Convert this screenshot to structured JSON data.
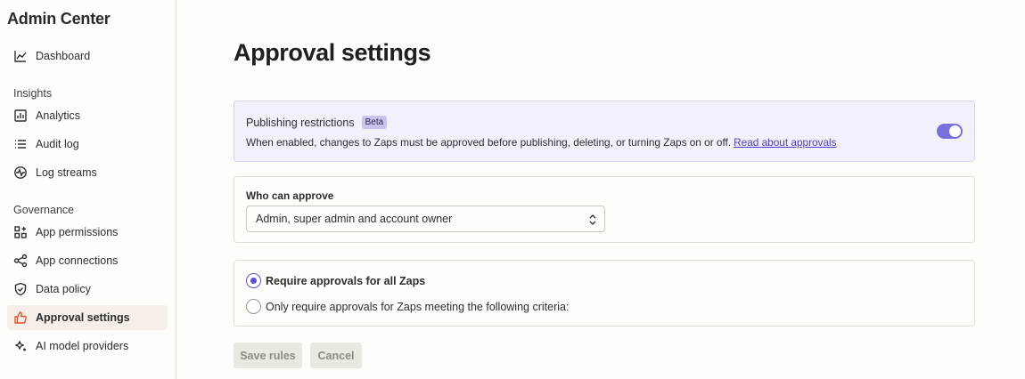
{
  "sidebar": {
    "title": "Admin Center",
    "items_top": [
      {
        "label": "Dashboard",
        "icon": "chart-line-icon"
      }
    ],
    "insights": {
      "title": "Insights",
      "items": [
        {
          "label": "Analytics",
          "icon": "bar-chart-icon"
        },
        {
          "label": "Audit log",
          "icon": "list-icon"
        },
        {
          "label": "Log streams",
          "icon": "pulse-icon"
        }
      ]
    },
    "governance": {
      "title": "Governance",
      "items": [
        {
          "label": "App permissions",
          "icon": "grid-plus-icon"
        },
        {
          "label": "App connections",
          "icon": "share-nodes-icon"
        },
        {
          "label": "Data policy",
          "icon": "shield-check-icon"
        },
        {
          "label": "Approval settings",
          "icon": "thumbs-up-icon",
          "active": true
        },
        {
          "label": "AI model providers",
          "icon": "sparkle-icon"
        }
      ]
    }
  },
  "main": {
    "title": "Approval settings",
    "restrictions": {
      "title": "Publishing restrictions",
      "badge": "Beta",
      "description": "When enabled, changes to Zaps must be approved before publishing, deleting, or turning Zaps on or off.",
      "link": "Read about approvals",
      "enabled": true
    },
    "approvers": {
      "label": "Who can approve",
      "selected": "Admin, super admin and account owner"
    },
    "scope": {
      "option_all": "Require approvals for all Zaps",
      "option_criteria": "Only require approvals for Zaps meeting the following criteria:",
      "selected": "all"
    },
    "actions": {
      "save": "Save rules",
      "cancel": "Cancel"
    }
  },
  "colors": {
    "accent": "#5b50d6",
    "toggle": "#7a6fdc",
    "active_icon": "#e8542a",
    "restrict_bg": "#f2f0fb"
  }
}
